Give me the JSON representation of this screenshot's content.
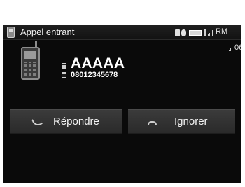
{
  "header": {
    "title": "Appel entrant",
    "title_icon": "phone-handset-icon",
    "status_icons": [
      "bluetooth-icon",
      "bluetooth-icon",
      "battery-icon",
      "signal-strength-icon"
    ],
    "roaming": "RM"
  },
  "call": {
    "caller_name": "AAAAA",
    "caller_number": "08012345678",
    "duration": "06",
    "contact_icon": "mobile-phone-icon",
    "name_icon": "contact-card-icon",
    "number_icon": "phone-number-icon",
    "volume_icon": "volume-icon"
  },
  "buttons": {
    "answer_label": "Répondre",
    "answer_icon": "answer-call-icon",
    "ignore_label": "Ignorer",
    "ignore_icon": "hang-up-icon"
  },
  "colors": {
    "background": "#0a0a0a",
    "button": "#333333",
    "text": "#ffffff"
  }
}
